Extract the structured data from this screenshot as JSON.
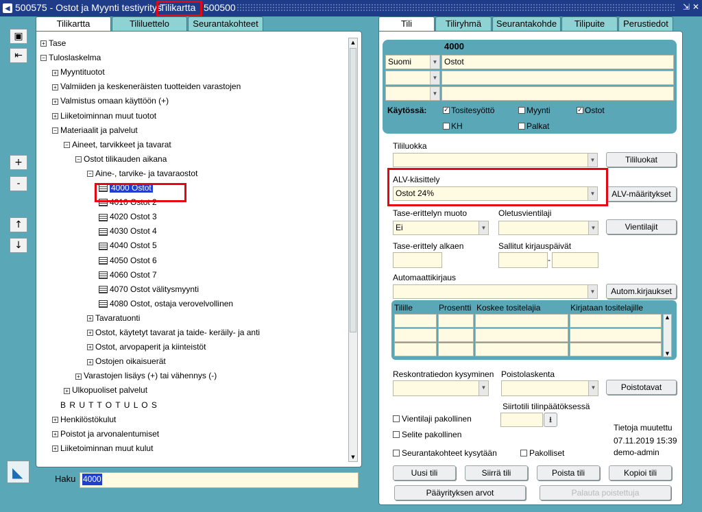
{
  "window": {
    "title_prefix": "500575 - Ostot ja Myynti testiyritys",
    "title_highlight": "Tilikartta",
    "title_suffix": "500500"
  },
  "left_tabs": [
    "Tilikartta",
    "Tililuettelo",
    "Seurantakohteet"
  ],
  "right_tabs": [
    "Tili",
    "Tiliryhmä",
    "Seurantakohde",
    "Tilipuite",
    "Perustiedot"
  ],
  "tree": [
    {
      "label": "Tase",
      "depth": 0,
      "icon": "plus"
    },
    {
      "label": "Tuloslaskelma",
      "depth": 0,
      "icon": "minus"
    },
    {
      "label": "Myyntituotot",
      "depth": 1,
      "icon": "plus"
    },
    {
      "label": "Valmiiden ja keskeneräisten tuotteiden varastojen",
      "depth": 1,
      "icon": "plus"
    },
    {
      "label": "Valmistus omaan käyttöön (+)",
      "depth": 1,
      "icon": "plus"
    },
    {
      "label": "Liiketoiminnan muut tuotot",
      "depth": 1,
      "icon": "plus"
    },
    {
      "label": "Materiaalit ja palvelut",
      "depth": 1,
      "icon": "minus"
    },
    {
      "label": "Aineet, tarvikkeet ja tavarat",
      "depth": 2,
      "icon": "minus"
    },
    {
      "label": "Ostot tilikauden aikana",
      "depth": 3,
      "icon": "minus"
    },
    {
      "label": "Aine-, tarvike- ja tavaraostot",
      "depth": 4,
      "icon": "minus"
    },
    {
      "label": "4000 Ostot",
      "depth": 5,
      "icon": "leaf",
      "selected": true
    },
    {
      "label": "4010 Ostot 2",
      "depth": 5,
      "icon": "leaf"
    },
    {
      "label": "4020 Ostot 3",
      "depth": 5,
      "icon": "leaf"
    },
    {
      "label": "4030 Ostot 4",
      "depth": 5,
      "icon": "leaf"
    },
    {
      "label": "4040 Ostot 5",
      "depth": 5,
      "icon": "leaf"
    },
    {
      "label": "4050 Ostot 6",
      "depth": 5,
      "icon": "leaf"
    },
    {
      "label": "4060 Ostot 7",
      "depth": 5,
      "icon": "leaf"
    },
    {
      "label": "4070 Ostot välitysmyynti",
      "depth": 5,
      "icon": "leaf"
    },
    {
      "label": "4080 Ostot, ostaja verovelvollinen",
      "depth": 5,
      "icon": "leaf"
    },
    {
      "label": "Tavaratuonti",
      "depth": 4,
      "icon": "plus"
    },
    {
      "label": "Ostot, käytetyt tavarat ja taide- keräily- ja anti",
      "depth": 4,
      "icon": "plus"
    },
    {
      "label": "Ostot, arvopaperit ja kiinteistöt",
      "depth": 4,
      "icon": "plus"
    },
    {
      "label": "Ostojen oikaisuerät",
      "depth": 4,
      "icon": "plus"
    },
    {
      "label": "Varastojen lisäys (+) tai vähennys (-)",
      "depth": 3,
      "icon": "plus"
    },
    {
      "label": "Ulkopuoliset palvelut",
      "depth": 2,
      "icon": "plus"
    },
    {
      "label": "B R U T T O T U L O S",
      "depth": 1,
      "icon": "none"
    },
    {
      "label": "Henkilöstökulut",
      "depth": 1,
      "icon": "plus"
    },
    {
      "label": "Poistot ja arvonalentumiset",
      "depth": 1,
      "icon": "plus"
    },
    {
      "label": "Liiketoiminnan muut kulut",
      "depth": 1,
      "icon": "plus"
    }
  ],
  "search": {
    "label": "Haku",
    "value": "4000"
  },
  "account": {
    "number": "4000",
    "language": "Suomi",
    "name": "Ostot",
    "kaytossa_label": "Käytössä:",
    "checks": [
      {
        "label": "Tositesyöttö",
        "checked": true
      },
      {
        "label": "Myynti",
        "checked": false
      },
      {
        "label": "Ostot",
        "checked": true
      },
      {
        "label": "KH",
        "checked": false
      },
      {
        "label": "Palkat",
        "checked": false
      }
    ]
  },
  "form": {
    "tililuokka_label": "Tililuokka",
    "tililuokka_value": "",
    "tililuokat_btn": "Tililuokat",
    "alv_label": "ALV-käsittely",
    "alv_value": "Ostot 24%",
    "alv_btn": "ALV-määritykset",
    "tase_muoto_label": "Tase-erittelyn muoto",
    "tase_muoto_value": "Ei",
    "oletusvientilaji_label": "Oletusvientilaji",
    "vientilajit_btn": "Vientilajit",
    "tase_alkaen_label": "Tase-erittely alkaen",
    "sallitut_label": "Sallitut kirjauspäivät",
    "dash": "-",
    "automaattikirjaus_label": "Automaattikirjaus",
    "autom_btn": "Autom.kirjaukset",
    "grid_headers": [
      "Tilille",
      "Prosentti",
      "Koskee tositelajia",
      "Kirjataan tositelajille"
    ],
    "reskontra_label": "Reskontratiedon kysyminen",
    "poistolaskenta_label": "Poistolaskenta",
    "poistotavat_btn": "Poistotavat",
    "siirtotili_label": "Siirtotili tilinpäätöksessä",
    "vientilaji_pakollinen": "Vientilaji pakollinen",
    "selite_pakollinen": "Selite pakollinen",
    "seurantakohteet_kysytaan": "Seurantakohteet kysytään",
    "pakolliset": "Pakolliset",
    "tietoja_label": "Tietoja muutettu",
    "tietoja_date": "07.11.2019 15:39",
    "tietoja_user": "demo-admin"
  },
  "buttons": {
    "uusi": "Uusi tili",
    "siirra": "Siirrä tili",
    "poista": "Poista tili",
    "kopioi": "Kopioi tili",
    "paayritys": "Pääyrityksen arvot",
    "palauta": "Palauta poistettuja"
  },
  "side_buttons": {
    "plus": "+",
    "minus": "-",
    "up": "↑",
    "down": "↓"
  }
}
